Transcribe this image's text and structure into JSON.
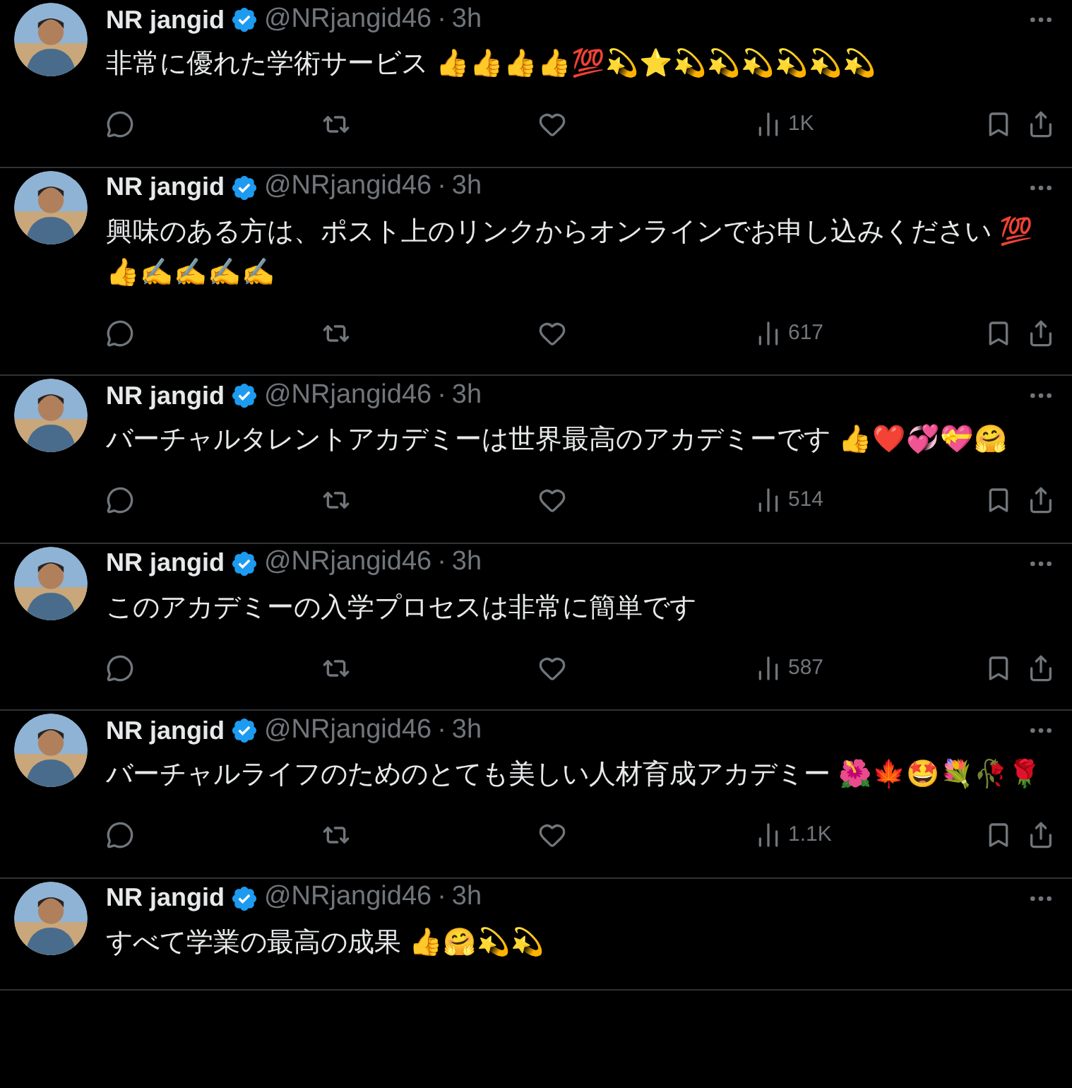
{
  "separator": "·",
  "tweets": [
    {
      "name": "NR jangid",
      "handle": "@NRjangid46",
      "time": "3h",
      "text": "非常に優れた学術サービス 👍👍👍👍💯💫⭐💫💫💫💫💫💫",
      "views": "1K"
    },
    {
      "name": "NR jangid",
      "handle": "@NRjangid46",
      "time": "3h",
      "text": "興味のある方は、ポスト上のリンクからオンラインでお申し込みください 💯👍✍✍✍✍",
      "views": "617"
    },
    {
      "name": "NR jangid",
      "handle": "@NRjangid46",
      "time": "3h",
      "text": "バーチャルタレントアカデミーは世界最高のアカデミーです 👍❤️💞💝🤗",
      "views": "514"
    },
    {
      "name": "NR jangid",
      "handle": "@NRjangid46",
      "time": "3h",
      "text": "このアカデミーの入学プロセスは非常に簡単です",
      "views": "587"
    },
    {
      "name": "NR jangid",
      "handle": "@NRjangid46",
      "time": "3h",
      "text": "バーチャルライフのためのとても美しい人材育成アカデミー 🌺🍁🤩💐🥀🌹",
      "views": "1.1K"
    },
    {
      "name": "NR jangid",
      "handle": "@NRjangid46",
      "time": "3h",
      "text": "すべて学業の最高の成果 👍🤗💫💫"
    }
  ]
}
